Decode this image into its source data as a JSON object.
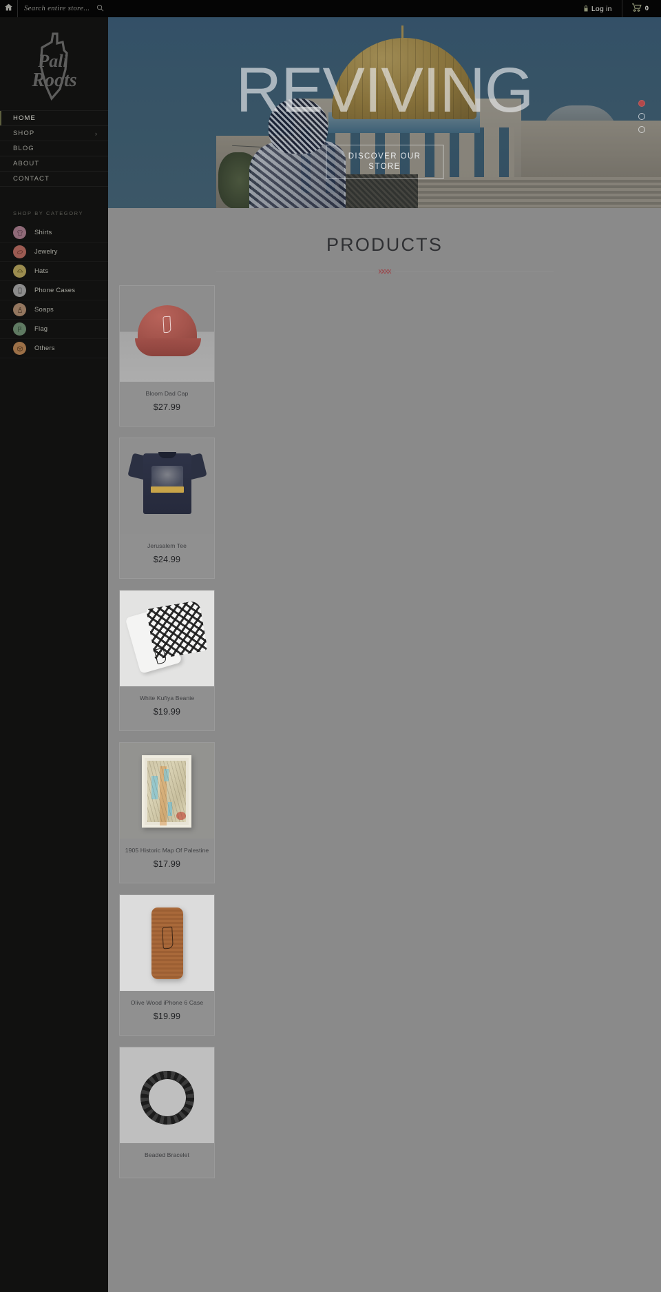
{
  "topbar": {
    "home_icon": "home-icon",
    "search_placeholder": "Search entire store...",
    "search_value": "",
    "search_icon": "search-icon",
    "login_label": "Log in",
    "login_icon": "lock-icon",
    "cart_icon": "cart-icon",
    "cart_count": "0"
  },
  "sidebar": {
    "logo_text": "Pali Roots",
    "nav": [
      {
        "label": "HOME",
        "active": true,
        "has_chevron": false
      },
      {
        "label": "SHOP",
        "active": false,
        "has_chevron": true
      },
      {
        "label": "BLOG",
        "active": false,
        "has_chevron": false
      },
      {
        "label": "ABOUT",
        "active": false,
        "has_chevron": false
      },
      {
        "label": "CONTACT",
        "active": false,
        "has_chevron": false
      }
    ],
    "category_heading": "SHOP BY CATEGORY",
    "categories": [
      {
        "label": "Shirts",
        "icon": "tshirt-icon",
        "color": "#8f6a78"
      },
      {
        "label": "Jewelry",
        "icon": "bracelet-icon",
        "color": "#9c5b52"
      },
      {
        "label": "Hats",
        "icon": "cap-icon",
        "color": "#9b8c4f"
      },
      {
        "label": "Phone Cases",
        "icon": "phone-icon",
        "color": "#8c8c8c"
      },
      {
        "label": "Soaps",
        "icon": "soap-icon",
        "color": "#94775f"
      },
      {
        "label": "Flag",
        "icon": "flag-icon",
        "color": "#5f7a62"
      },
      {
        "label": "Others",
        "icon": "box-icon",
        "color": "#9c7047"
      }
    ]
  },
  "hero": {
    "title": "REVIVING",
    "cta_label": "DISCOVER OUR STORE",
    "slides": [
      {
        "active": true
      },
      {
        "active": false
      },
      {
        "active": false
      }
    ],
    "accent_color": "#b3484a"
  },
  "main": {
    "section_title": "PRODUCTS",
    "divider_mark": "xxxx",
    "products": [
      {
        "name": "Bloom Dad Cap",
        "price": "$27.99",
        "art": "cap"
      },
      {
        "name": "Jerusalem Tee",
        "price": "$24.99",
        "art": "tee"
      },
      {
        "name": "White Kufiya Beanie",
        "price": "$19.99",
        "art": "kufiya"
      },
      {
        "name": "1905 Historic Map Of Palestine",
        "price": "$17.99",
        "art": "map"
      },
      {
        "name": "Olive Wood iPhone 6 Case",
        "price": "$19.99",
        "art": "wood"
      },
      {
        "name": "Beaded Bracelet",
        "price": "",
        "art": "bracelet"
      }
    ]
  }
}
